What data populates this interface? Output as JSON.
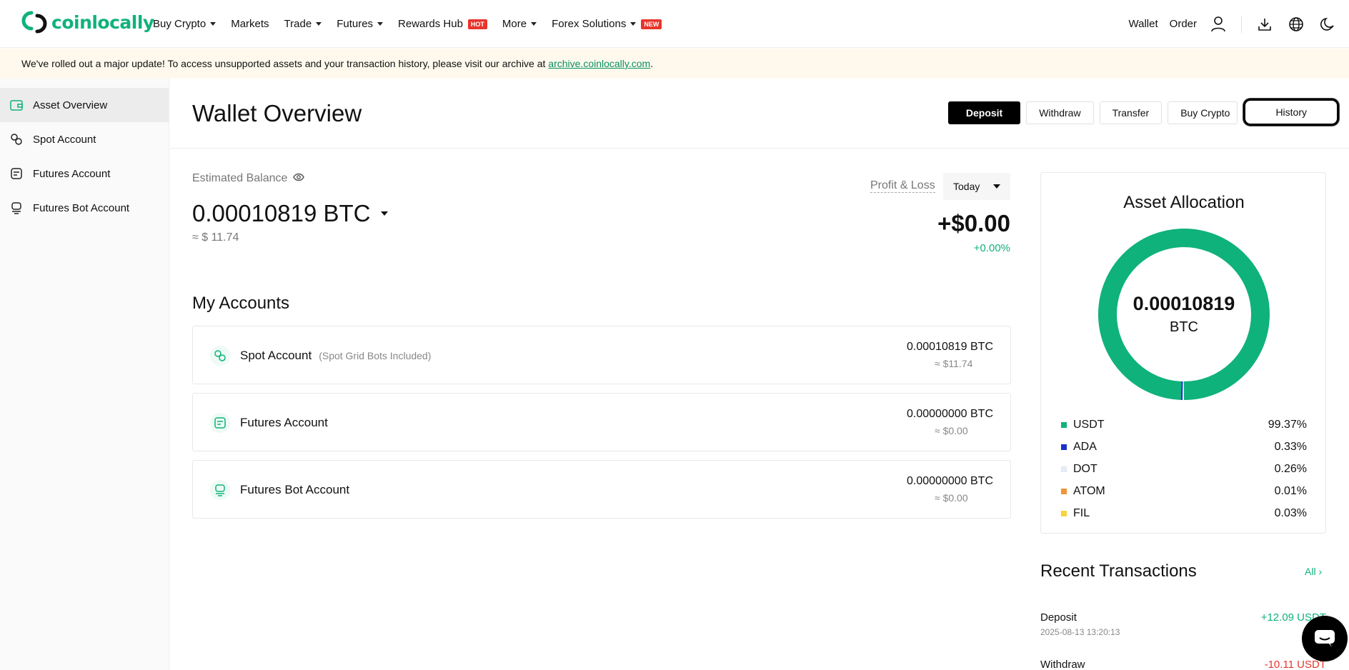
{
  "brand": {
    "name": "coinlocally",
    "color": "#0fb27a"
  },
  "nav": {
    "items": [
      {
        "label": "Buy Crypto",
        "caret": true,
        "badge": ""
      },
      {
        "label": "Markets",
        "caret": false,
        "badge": ""
      },
      {
        "label": "Trade",
        "caret": true,
        "badge": ""
      },
      {
        "label": "Futures",
        "caret": true,
        "badge": ""
      },
      {
        "label": "Rewards Hub",
        "caret": false,
        "badge": "HOT"
      },
      {
        "label": "More",
        "caret": true,
        "badge": ""
      },
      {
        "label": "Forex Solutions",
        "caret": true,
        "badge": "NEW"
      }
    ],
    "right": {
      "wallet": "Wallet",
      "order": "Order"
    },
    "icons": [
      "user-icon",
      "download-icon",
      "globe-icon",
      "moon-icon"
    ]
  },
  "notice": {
    "text": "We've rolled out a major update! To access unsupported assets and your transaction history, please visit our archive at ",
    "link": "archive.coinlocally.com",
    "suffix": "."
  },
  "sidebar": {
    "items": [
      {
        "label": "Asset Overview",
        "icon": "wallet-icon",
        "active": true
      },
      {
        "label": "Spot Account",
        "icon": "spot-icon",
        "active": false
      },
      {
        "label": "Futures Account",
        "icon": "futures-icon",
        "active": false
      },
      {
        "label": "Futures Bot Account",
        "icon": "bot-icon",
        "active": false
      }
    ]
  },
  "page": {
    "title": "Wallet Overview",
    "actions": {
      "deposit": "Deposit",
      "withdraw": "Withdraw",
      "transfer": "Transfer",
      "buy_crypto": "Buy Crypto",
      "history": "History"
    }
  },
  "balance": {
    "label": "Estimated Balance",
    "value": "0.00010819 BTC",
    "usd": "≈ $ 11.74"
  },
  "pnl": {
    "label": "Profit & Loss",
    "period": "Today",
    "value": "+$0.00",
    "pct": "+0.00%"
  },
  "accounts": {
    "title": "My Accounts",
    "items": [
      {
        "name": "Spot Account",
        "sub": "(Spot Grid Bots Included)",
        "btc": "0.00010819 BTC",
        "usd": "≈ $11.74",
        "icon": "spot-icon"
      },
      {
        "name": "Futures Account",
        "sub": "",
        "btc": "0.00000000 BTC",
        "usd": "≈ $0.00",
        "icon": "futures-icon"
      },
      {
        "name": "Futures Bot Account",
        "sub": "",
        "btc": "0.00000000 BTC",
        "usd": "≈ $0.00",
        "icon": "bot-icon"
      }
    ]
  },
  "allocation": {
    "title": "Asset Allocation",
    "center_value": "0.00010819",
    "center_unit": "BTC"
  },
  "chart_data": {
    "type": "pie",
    "title": "Asset Allocation",
    "categories": [
      "USDT",
      "ADA",
      "DOT",
      "ATOM",
      "FIL"
    ],
    "values": [
      99.37,
      0.33,
      0.26,
      0.01,
      0.03
    ],
    "labels": [
      "99.37%",
      "0.33%",
      "0.26%",
      "0.01%",
      "0.03%"
    ],
    "colors": [
      "#0fb27a",
      "#1a2fd0",
      "#e8eef8",
      "#f0953a",
      "#f6d43c"
    ],
    "legend": "bottom"
  },
  "recent": {
    "title": "Recent Transactions",
    "all": "All",
    "items": [
      {
        "type": "Deposit",
        "time": "2025-08-13 13:20:13",
        "amount": "+12.09 USDT",
        "color": "#0fb27a"
      },
      {
        "type": "Withdraw",
        "time": "",
        "amount": "-10.11 USDT",
        "color": "#e8352d"
      }
    ]
  }
}
